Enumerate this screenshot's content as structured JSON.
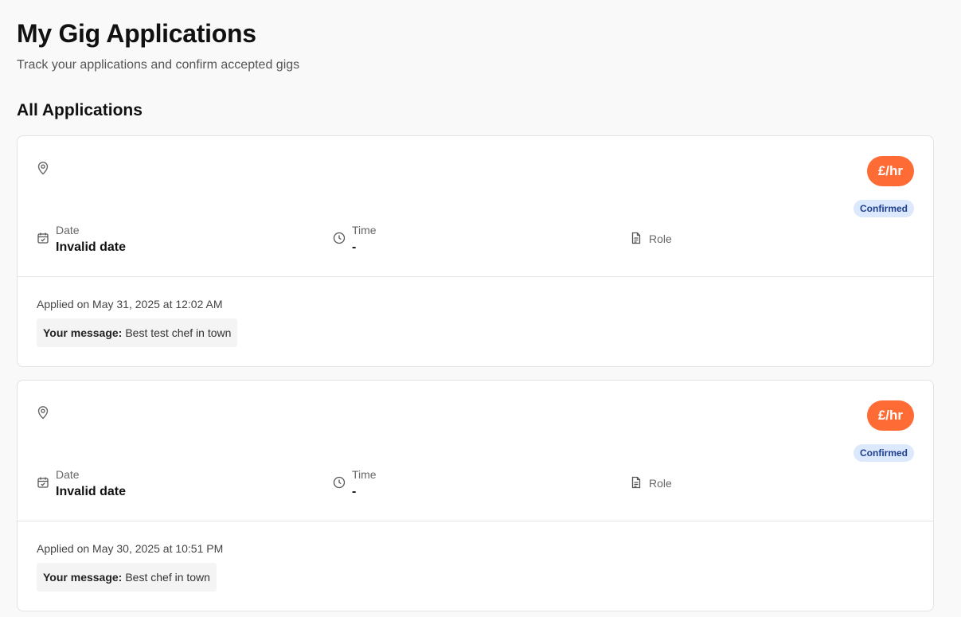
{
  "page": {
    "title": "My Gig Applications",
    "subtitle": "Track your applications and confirm accepted gigs",
    "section_title": "All Applications"
  },
  "colors": {
    "accent": "#ff6b35",
    "status_bg": "#dce8fb",
    "status_text": "#1e3f8f"
  },
  "icons": [
    "map-pin-icon",
    "calendar-icon",
    "clock-icon",
    "document-icon"
  ],
  "applications": [
    {
      "location": "",
      "rate": "£/hr",
      "status": "Confirmed",
      "date_label": "Date",
      "date_value": "Invalid date",
      "time_label": "Time",
      "time_value": "-",
      "role_label": "Role",
      "applied_text": "Applied on May 31, 2025 at 12:02 AM",
      "message_label": "Your message:",
      "message_text": "Best test chef in town"
    },
    {
      "location": "",
      "rate": "£/hr",
      "status": "Confirmed",
      "date_label": "Date",
      "date_value": "Invalid date",
      "time_label": "Time",
      "time_value": "-",
      "role_label": "Role",
      "applied_text": "Applied on May 30, 2025 at 10:51 PM",
      "message_label": "Your message:",
      "message_text": "Best chef in town"
    }
  ]
}
